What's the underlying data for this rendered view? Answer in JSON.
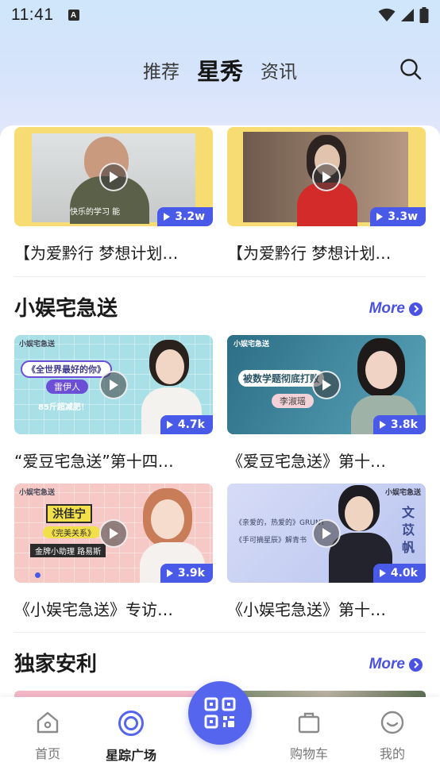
{
  "status": {
    "time": "11:41",
    "notification_glyph": "A"
  },
  "header": {
    "tabs": [
      {
        "label": "推荐",
        "active": false
      },
      {
        "label": "星秀",
        "active": true
      },
      {
        "label": "资讯",
        "active": false
      }
    ],
    "search_icon": "search-icon"
  },
  "top_cards": [
    {
      "title": "【为爱黔行 梦想计划…",
      "views": "3.2w",
      "caption": "快乐的学习 能",
      "bg": "#f6dc72"
    },
    {
      "title": "【为爱黔行 梦想计划…",
      "views": "3.3w",
      "bg": "#f6dc72"
    }
  ],
  "section1": {
    "title": "小娱宅急送",
    "more": "More",
    "cards": [
      {
        "title": "“爱豆宅急送”第十四…",
        "views": "4.7k",
        "logo": "小娱宅急送",
        "text1": "《全世界最好的你》",
        "text2": "雷伊人",
        "text3": "85斤超减肥！",
        "bg": "#a9e0e7"
      },
      {
        "title": "《爱豆宅急送》第十…",
        "views": "3.8k",
        "logo": "小娱宅急送",
        "text1": "被数学题彻底打败",
        "text2": "李淑瑶",
        "bg": "#36758c"
      },
      {
        "title": "《小娱宅急送》专访…",
        "views": "3.9k",
        "logo": "小娱宅急送",
        "text1": "洪佳宁",
        "text2": "《完美关系》",
        "text3": "金牌小助理 路易斯",
        "bg": "#f6c9c6"
      },
      {
        "title": "《小娱宅急送》第十…",
        "views": "4.0k",
        "logo": "小娱宅急送",
        "text1": "文苡帆",
        "text2": "《亲爱的，热爱的》GRUNT",
        "text3": "《手可摘星辰》解青书",
        "bg": "#c9d3f4"
      }
    ]
  },
  "section2": {
    "title": "独家安利",
    "more": "More"
  },
  "bottom_nav": [
    {
      "label": "首页",
      "icon": "home-icon",
      "active": false
    },
    {
      "label": "星踪广场",
      "icon": "target-icon",
      "active": true
    },
    {
      "label": "购物车",
      "icon": "bag-icon",
      "active": false
    },
    {
      "label": "我的",
      "icon": "smile-icon",
      "active": false
    }
  ],
  "center_button_icon": "qr-scan-icon",
  "colors": {
    "accent": "#4a52e4",
    "views_badge": "#4a5ae8",
    "scan_button": "#5565ee"
  }
}
